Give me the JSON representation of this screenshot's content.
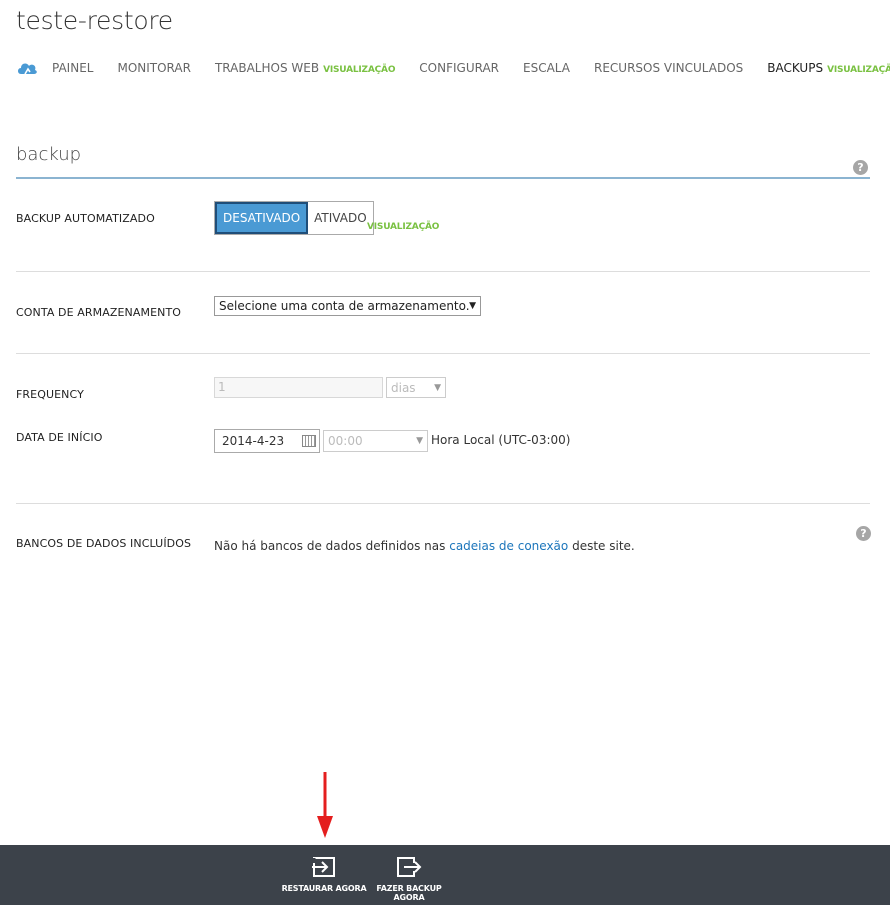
{
  "header": {
    "title": "teste-restore"
  },
  "tabs": [
    {
      "label": "PAINEL",
      "tag": ""
    },
    {
      "label": "MONITORAR",
      "tag": ""
    },
    {
      "label": "TRABALHOS WEB",
      "tag": "VISUALIZAÇÃO"
    },
    {
      "label": "CONFIGURAR",
      "tag": ""
    },
    {
      "label": "ESCALA",
      "tag": ""
    },
    {
      "label": "RECURSOS VINCULADOS",
      "tag": ""
    },
    {
      "label": "BACKUPS",
      "tag": "VISUALIZAÇÃO"
    }
  ],
  "section": {
    "title": "backup"
  },
  "backup_auto": {
    "label": "BACKUP AUTOMATIZADO",
    "off_label": "DESATIVADO",
    "on_label": "ATIVADO",
    "selected": "DESATIVADO",
    "tag": "VISUALIZAÇÃO"
  },
  "storage": {
    "label": "CONTA DE ARMAZENAMENTO",
    "value": "Selecione uma conta de armazenamento."
  },
  "frequency": {
    "label": "FREQUENCY",
    "value": "1",
    "unit": "dias"
  },
  "start_date": {
    "label": "DATA DE INÍCIO",
    "date": "2014-4-23",
    "time": "00:00",
    "timezone": "Hora Local (UTC-03:00)"
  },
  "databases": {
    "label": "BANCOS DE DADOS INCLUÍDOS",
    "text_before": "Não há bancos de dados definidos nas",
    "link_text": "cadeias de conexão",
    "text_after": "deste site."
  },
  "help": {
    "glyph": "?"
  },
  "commands": {
    "restore": "RESTAURAR AGORA",
    "backup_line1": "FAZER BACKUP",
    "backup_line2": "AGORA"
  },
  "colors": {
    "accent": "#4a9ad4",
    "preview": "#7ac142",
    "link": "#1b75bb",
    "command_bar": "#3c424a",
    "annotation_arrow": "#e41e1e"
  }
}
